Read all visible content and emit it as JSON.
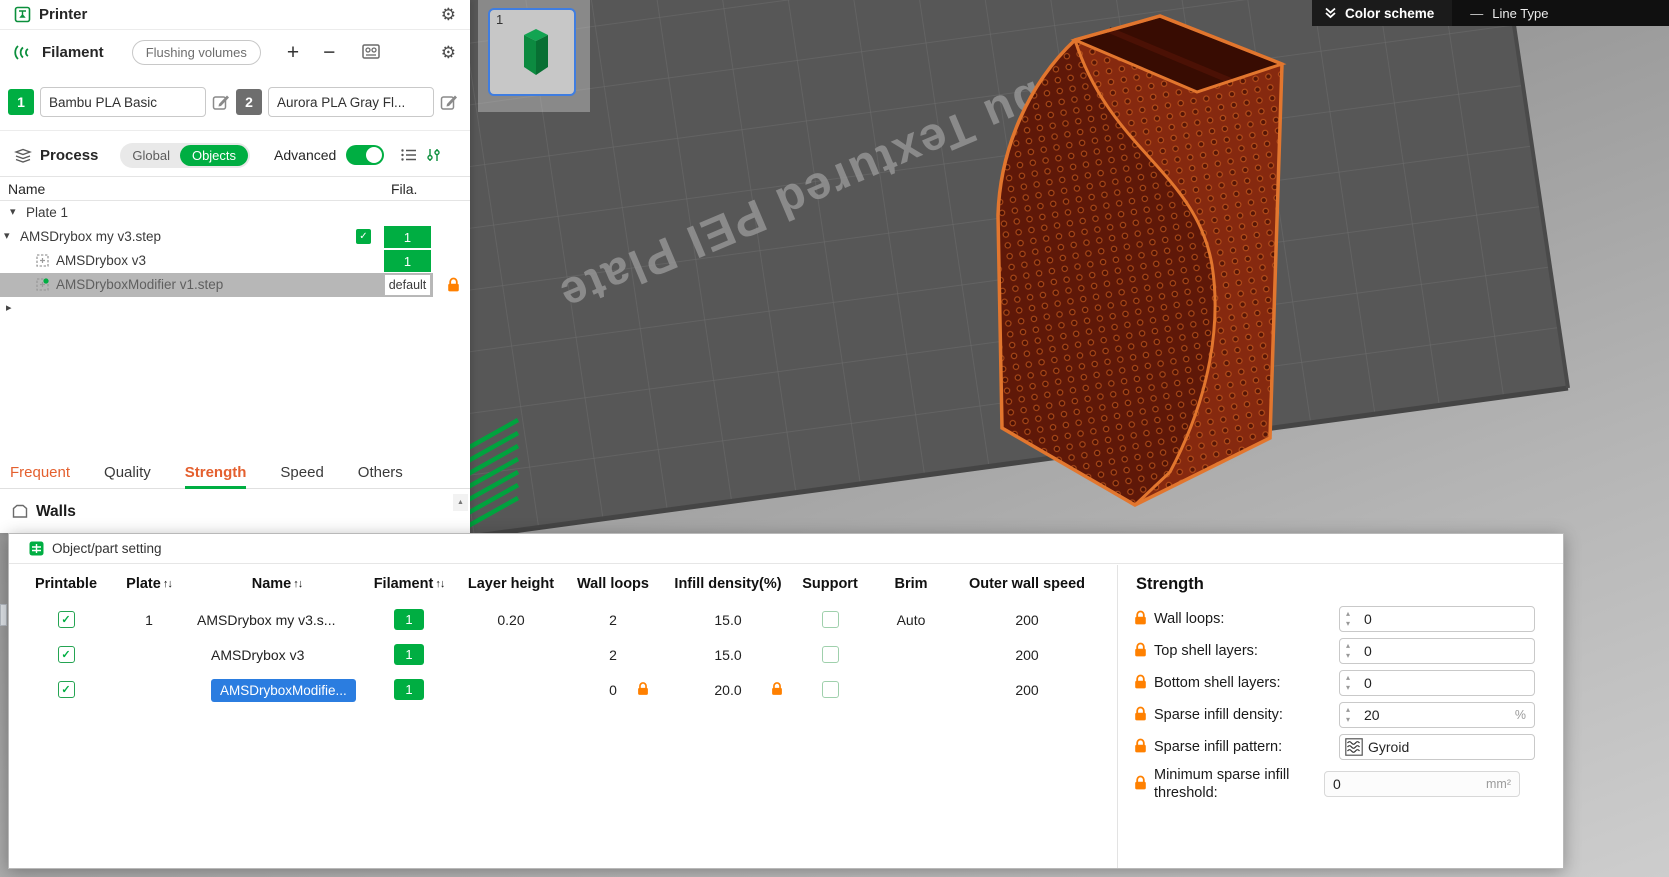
{
  "colors": {
    "green": "#00AE42",
    "tab_orange": "#E4602F",
    "selected_blue": "#2B7DE0",
    "lock_orange": "#FF8000"
  },
  "printer": {
    "title": "Printer"
  },
  "filament": {
    "title": "Filament",
    "flushing_button": "Flushing volumes",
    "slots": [
      {
        "num": "1",
        "name": "Bambu PLA Basic"
      },
      {
        "num": "2",
        "name": "Aurora PLA Gray Fl..."
      }
    ]
  },
  "process": {
    "title": "Process",
    "segments": {
      "global": "Global",
      "objects": "Objects"
    },
    "advanced_label": "Advanced"
  },
  "tree": {
    "name_header": "Name",
    "fila_header": "Fila.",
    "rows": [
      {
        "label": "Plate 1"
      },
      {
        "label": "AMSDrybox my v3.step",
        "fila": "1"
      },
      {
        "label": "AMSDrybox v3",
        "fila": "1"
      },
      {
        "label": "AMSDryboxModifier v1.step",
        "fila": "default"
      }
    ]
  },
  "tabs": {
    "items": [
      "Frequent",
      "Quality",
      "Strength",
      "Speed",
      "Others"
    ]
  },
  "walls": {
    "title": "Walls"
  },
  "dialog": {
    "title": "Object/part setting",
    "sort_glyph": "↑↓",
    "columns": [
      "Printable",
      "Plate",
      "Name",
      "Filament",
      "Layer height",
      "Wall loops",
      "Infill density(%)",
      "Support",
      "Brim",
      "Outer wall speed"
    ],
    "rows": [
      {
        "plate": "1",
        "name": "AMSDrybox my v3.s...",
        "filament": "1",
        "layer_height": "0.20",
        "wall_loops": "2",
        "infill": "15.0",
        "brim": "Auto",
        "speed": "200"
      },
      {
        "plate": "",
        "name": "AMSDrybox v3",
        "filament": "1",
        "layer_height": "",
        "wall_loops": "2",
        "infill": "15.0",
        "brim": "",
        "speed": "200"
      },
      {
        "plate": "",
        "name": "AMSDryboxModifie...",
        "filament": "1",
        "layer_height": "",
        "wall_loops": "0",
        "infill": "20.0",
        "brim": "",
        "speed": "200"
      }
    ]
  },
  "strength": {
    "title": "Strength",
    "rows": [
      {
        "label": "Wall loops:",
        "value": "0"
      },
      {
        "label": "Top shell layers:",
        "value": "0"
      },
      {
        "label": "Bottom shell layers:",
        "value": "0"
      },
      {
        "label": "Sparse infill density:",
        "value": "20",
        "unit": "%"
      },
      {
        "label": "Sparse infill pattern:",
        "value": "Gyroid"
      },
      {
        "label": "Minimum sparse infill threshold:",
        "value": "0",
        "unit": "mm²"
      }
    ]
  },
  "viewport": {
    "plate_text": "Bambu Textured PEI Plate",
    "thumbnail_label": "1",
    "color_scheme_label": "Color scheme",
    "line_type_label": "Line Type"
  },
  "icons": {
    "gear": "⚙",
    "plus": "+",
    "minus": "−",
    "caret_down": "▾",
    "caret_right": "▸",
    "check": "✓",
    "spin_up": "▴",
    "spin_down": "▾",
    "scroll_up": "▲",
    "dash": "—"
  }
}
